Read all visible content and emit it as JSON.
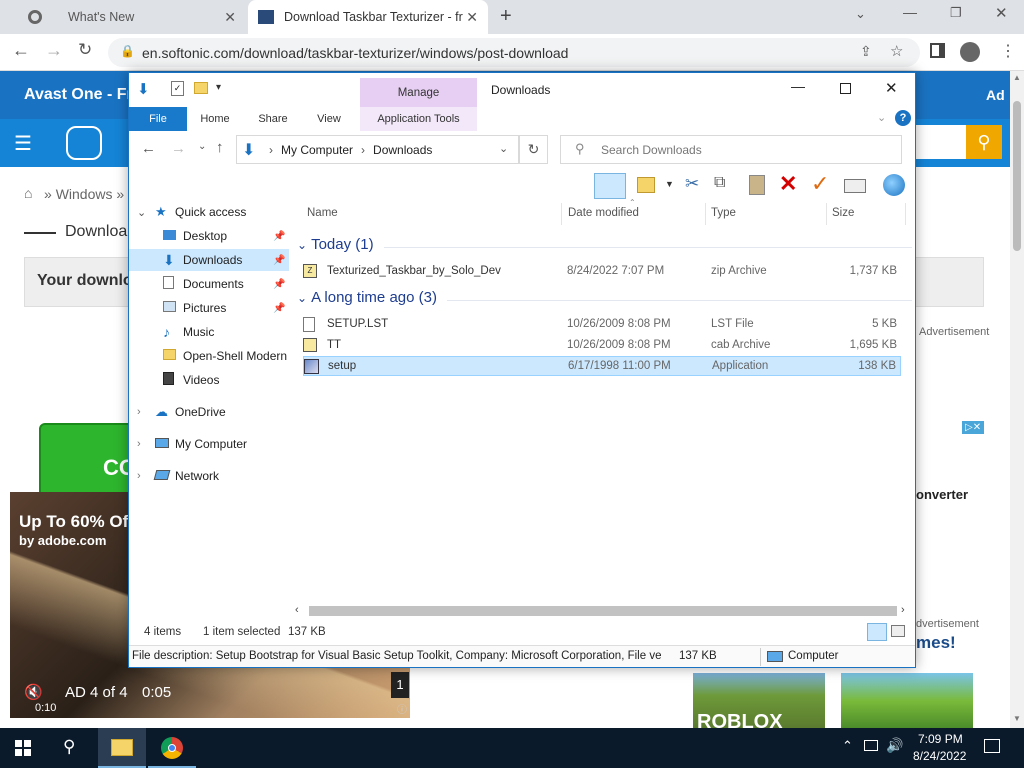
{
  "browser": {
    "tabs": [
      {
        "title": "What's New"
      },
      {
        "title": "Download Taskbar Texturizer - fr"
      }
    ],
    "url": "en.softonic.com/download/taskbar-texturizer/windows/post-download"
  },
  "site": {
    "banner_left": "Avast One - Fre",
    "banner_right": "Ad",
    "breadcrumb": "Windows",
    "download_heading": "Downloa",
    "your_download": "Your downlo",
    "advertisement_1": "Advertisement",
    "advertisement_2": "dvertisement",
    "converter": "onverter",
    "games": "mes!",
    "green_button": "CO",
    "roblox": "ROBLOX"
  },
  "video_ad": {
    "title": "Up To 60% Of",
    "source": "by adobe.com",
    "counter": "AD 4 of 4",
    "countdown": "0:05",
    "elapsed": "0:10",
    "badge": "1"
  },
  "explorer": {
    "title": "Downloads",
    "manage_label": "Manage",
    "ribbon_tabs": [
      "File",
      "Home",
      "Share",
      "View",
      "Application Tools"
    ],
    "breadcrumb": [
      "My Computer",
      "Downloads"
    ],
    "search_placeholder": "Search Downloads",
    "nav": {
      "quick_access": "Quick access",
      "items": [
        "Desktop",
        "Downloads",
        "Documents",
        "Pictures",
        "Music",
        "Open-Shell Modern",
        "Videos"
      ],
      "onedrive": "OneDrive",
      "my_computer": "My Computer",
      "network": "Network"
    },
    "columns": [
      "Name",
      "Date modified",
      "Type",
      "Size"
    ],
    "groups": [
      {
        "label": "Today (1)",
        "files": [
          {
            "name": "Texturized_Taskbar_by_Solo_Dev",
            "date": "8/24/2022 7:07 PM",
            "type": "zip Archive",
            "size": "1,737 KB"
          }
        ]
      },
      {
        "label": "A long time ago (3)",
        "files": [
          {
            "name": "SETUP.LST",
            "date": "10/26/2009 8:08 PM",
            "type": "LST File",
            "size": "5 KB"
          },
          {
            "name": "TT",
            "date": "10/26/2009 8:08 PM",
            "type": "cab Archive",
            "size": "1,695 KB"
          },
          {
            "name": "setup",
            "date": "6/17/1998 11:00 PM",
            "type": "Application",
            "size": "138 KB"
          }
        ]
      }
    ],
    "status": {
      "items": "4 items",
      "selected": "1 item selected",
      "selected_size": "137 KB"
    },
    "details": {
      "description": "File description: Setup Bootstrap for Visual Basic Setup Toolkit, Company: Microsoft Corporation, File ve",
      "size": "137 KB",
      "location": "Computer"
    }
  },
  "taskbar": {
    "time": "7:09 PM",
    "date": "8/24/2022"
  },
  "colors": {
    "accent": "#1a73c2",
    "selection": "#cce8ff",
    "manage_tab": "#e6cff2",
    "file_tab": "#1979ca"
  }
}
